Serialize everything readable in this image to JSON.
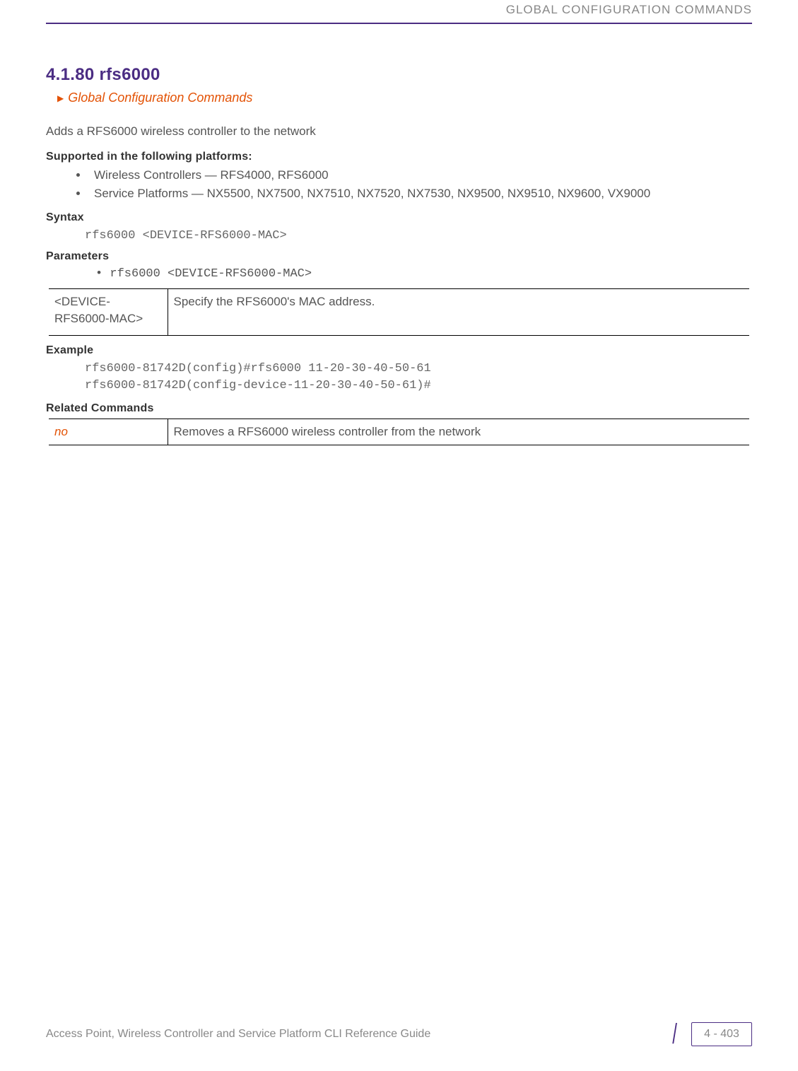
{
  "header": {
    "running_title": "GLOBAL CONFIGURATION COMMANDS"
  },
  "section": {
    "number_title": "4.1.80 rfs6000",
    "breadcrumb": "Global Configuration Commands",
    "intro": "Adds a RFS6000 wireless controller to the network",
    "supported_heading": "Supported in the following platforms:",
    "supported_items": [
      "Wireless Controllers — RFS4000, RFS6000",
      "Service Platforms — NX5500, NX7500, NX7510, NX7520, NX7530, NX9500, NX9510, NX9600, VX9000"
    ],
    "syntax_heading": "Syntax",
    "syntax_code": "rfs6000 <DEVICE-RFS6000-MAC>",
    "parameters_heading": "Parameters",
    "parameters_line": "• rfs6000 <DEVICE-RFS6000-MAC>",
    "parameters_table": [
      {
        "key": "<DEVICE-RFS6000-MAC>",
        "desc": "Specify the RFS6000's MAC address."
      }
    ],
    "example_heading": "Example",
    "example_code": "rfs6000-81742D(config)#rfs6000 11-20-30-40-50-61\nrfs6000-81742D(config-device-11-20-30-40-50-61)#",
    "related_heading": "Related Commands",
    "related_table": [
      {
        "cmd": "no",
        "desc": "Removes a RFS6000 wireless controller from the network"
      }
    ]
  },
  "footer": {
    "guide_title": "Access Point, Wireless Controller and Service Platform CLI Reference Guide",
    "page_number": "4 - 403"
  }
}
